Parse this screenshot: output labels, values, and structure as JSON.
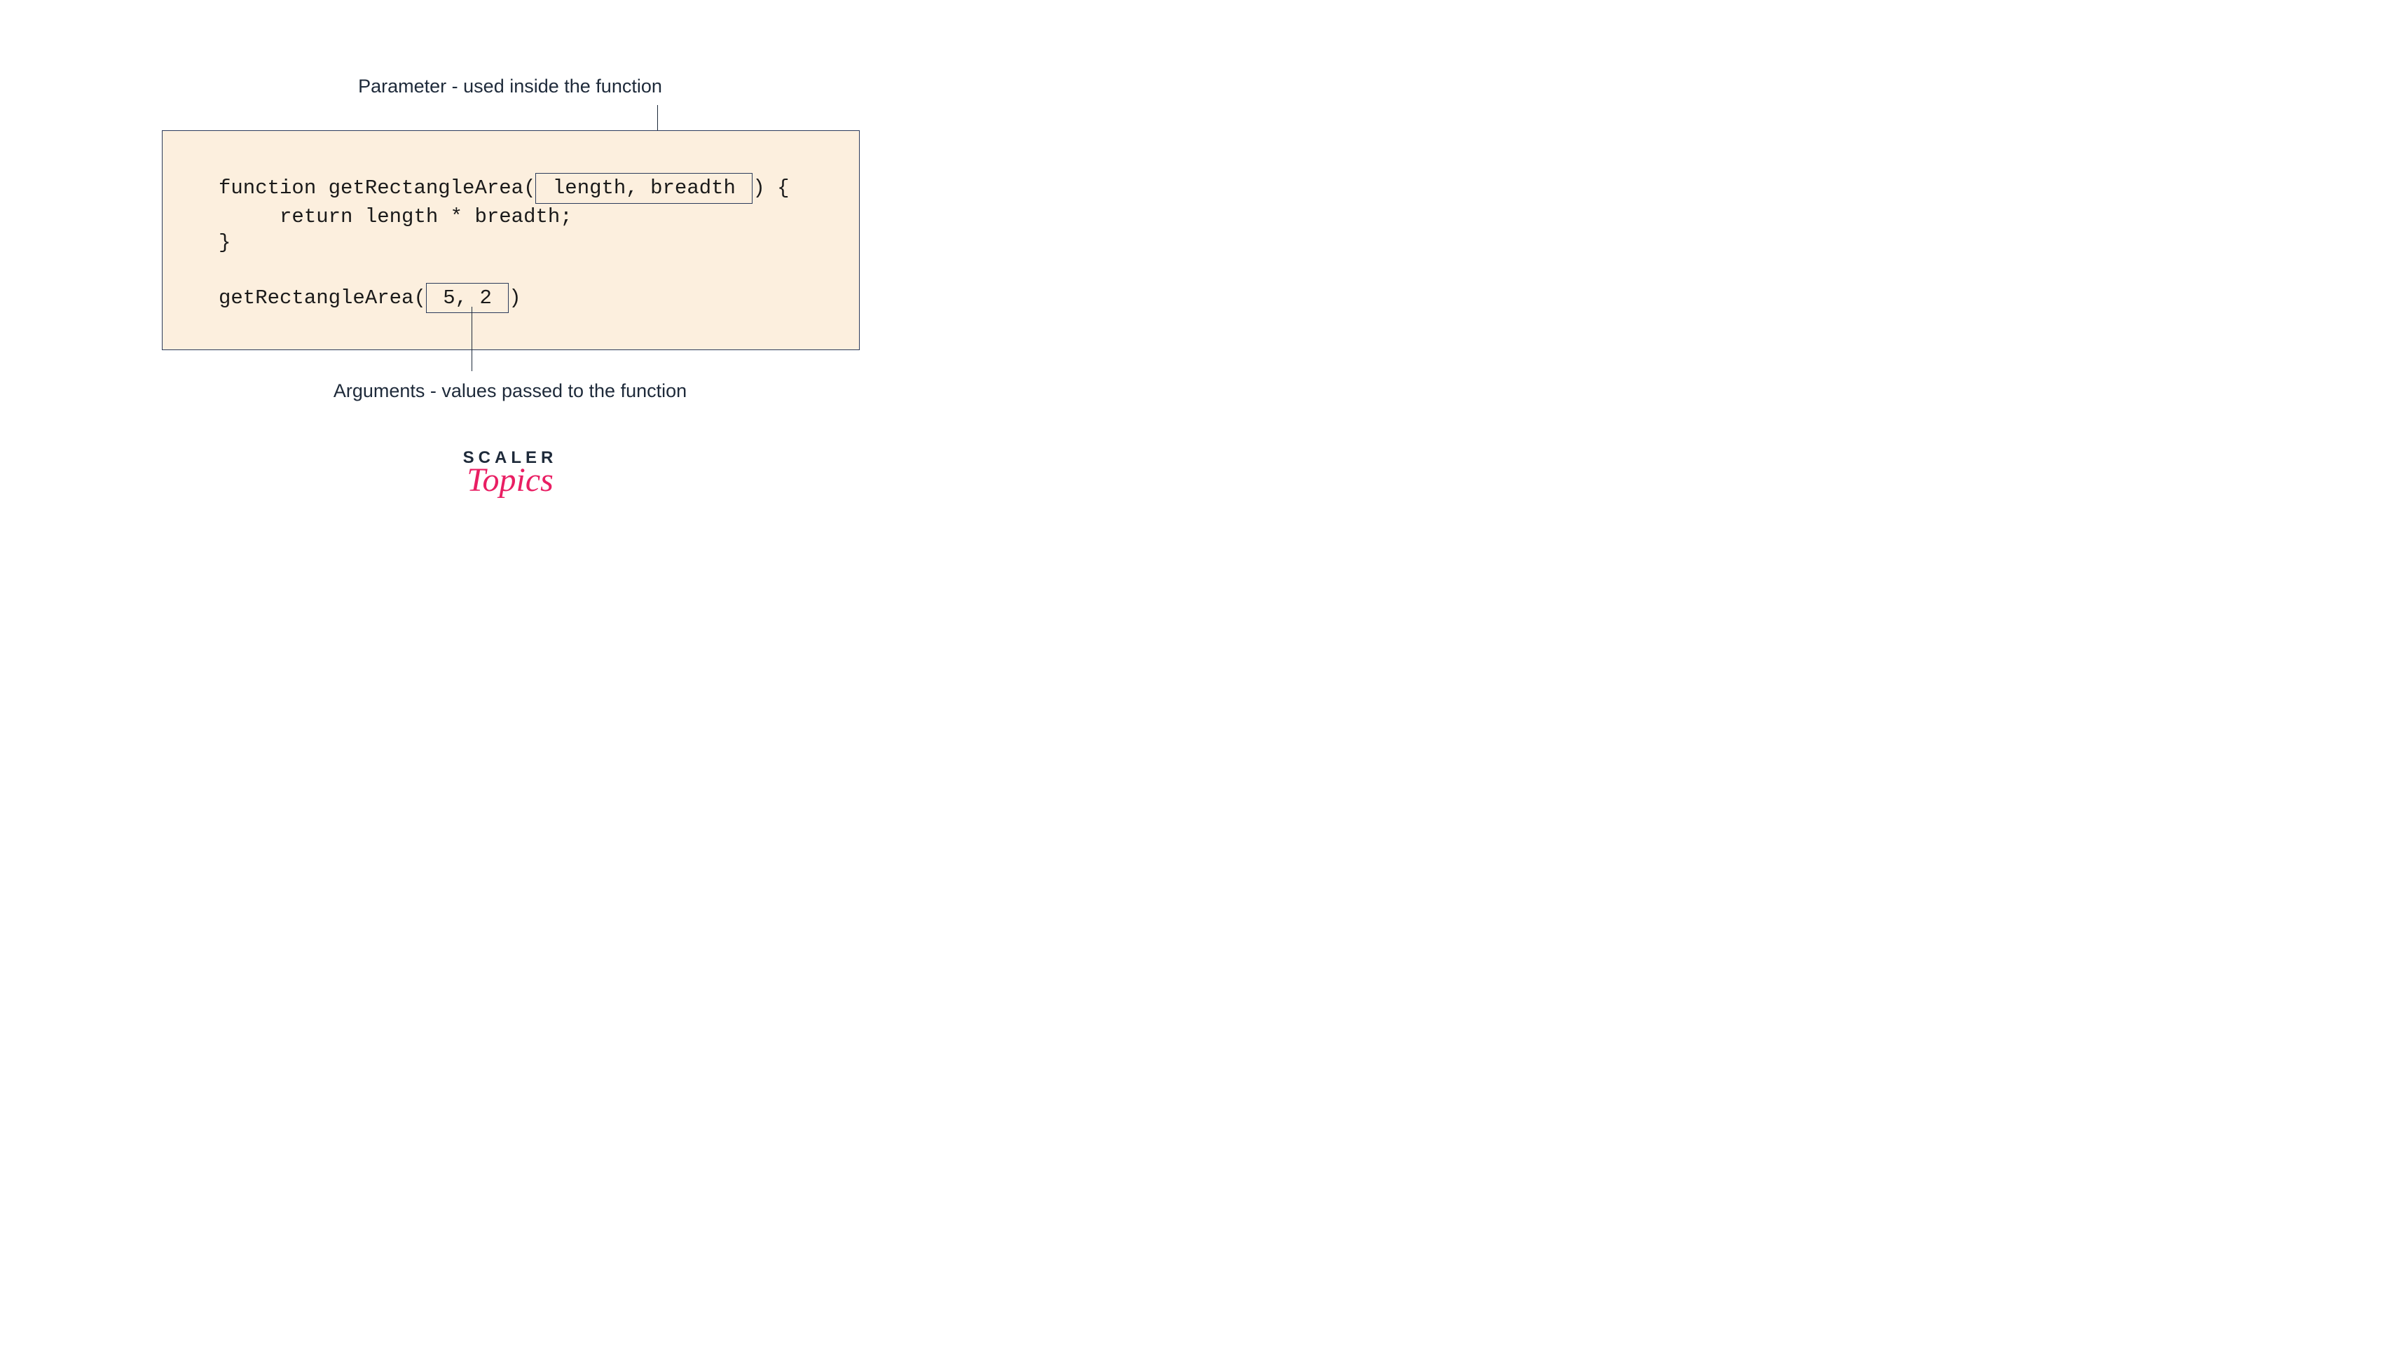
{
  "labels": {
    "parameter": "Parameter - used inside the function",
    "arguments": "Arguments - values passed to the function"
  },
  "code": {
    "line1_before": "function getRectangleArea(",
    "line1_params": " length, breadth ",
    "line1_after": ") {",
    "line2": "     return length * breadth;",
    "line3": "}",
    "line4_before": "getRectangleArea(",
    "line4_args": " 5, 2 ",
    "line4_after": ")"
  },
  "logo": {
    "scaler": "SCALER",
    "topics": "Topics"
  }
}
